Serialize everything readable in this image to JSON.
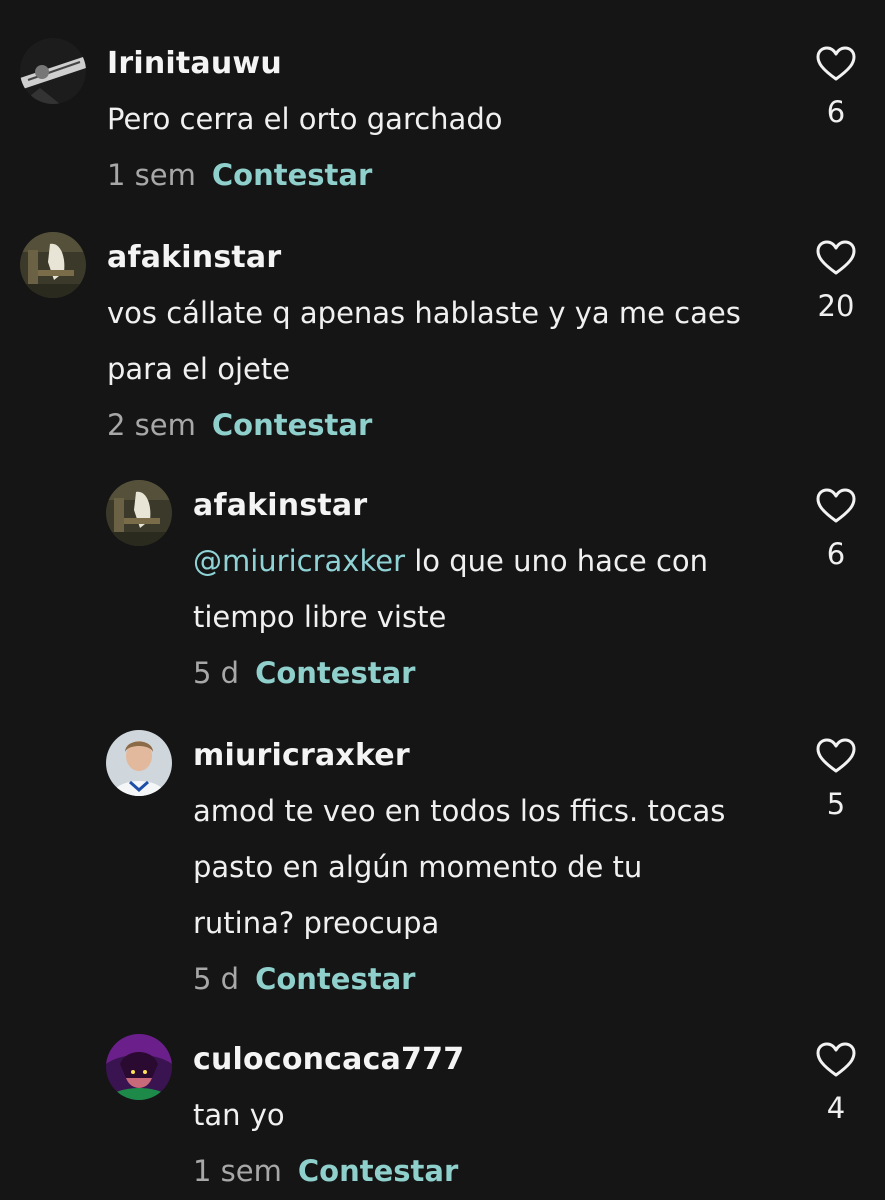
{
  "comments": [
    {
      "username": "Irinitauwu",
      "text_lines": [
        "Pero cerra el orto garchado"
      ],
      "time": "1 sem",
      "reply_label": "Contestar",
      "likes": "6"
    },
    {
      "username": "afakinstar",
      "text_lines": [
        "vos cállate q apenas hablaste y ya me caes",
        "para el ojete"
      ],
      "time": "2 sem",
      "reply_label": "Contestar",
      "likes": "20"
    },
    {
      "username": "afakinstar",
      "mention": "@miuricraxker",
      "text_lines": [
        " lo que uno hace con",
        "tiempo libre viste"
      ],
      "time": "5 d",
      "reply_label": "Contestar",
      "likes": "6"
    },
    {
      "username": "miuricraxker",
      "text_lines": [
        "amod te veo en todos los ffics. tocas",
        "pasto en algún momento de tu",
        "rutina? preocupa"
      ],
      "time": "5 d",
      "reply_label": "Contestar",
      "likes": "5"
    },
    {
      "username": "culoconcaca777",
      "text_lines": [
        "tan yo"
      ],
      "time": "1 sem",
      "reply_label": "Contestar",
      "likes": "4"
    }
  ],
  "colors": {
    "background": "#151515",
    "reply_link": "#8fd0cc",
    "mention": "#8fd3d6",
    "timestamp": "#a8a8a8"
  }
}
